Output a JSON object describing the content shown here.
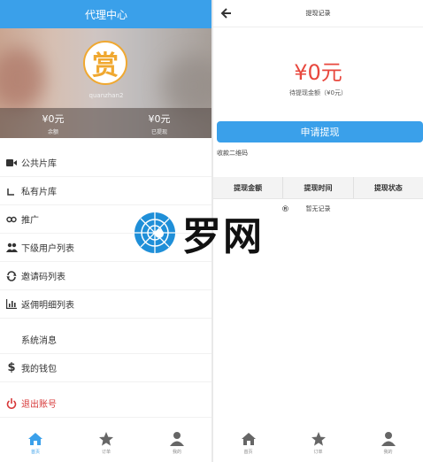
{
  "left": {
    "title": "代理中心",
    "avatar_char": "赏",
    "username": "quanzhan2",
    "stats": [
      {
        "value": "¥0元",
        "label": "余额"
      },
      {
        "value": "¥0元",
        "label": "已提现"
      }
    ],
    "menu": [
      {
        "icon": "video-camera-icon",
        "label": "公共片库"
      },
      {
        "icon": "folder-icon",
        "label": "私有片库"
      },
      {
        "icon": "share-link-icon",
        "label": "推广"
      },
      {
        "icon": "users-icon",
        "label": "下级用户列表"
      },
      {
        "icon": "refresh-icon",
        "label": "邀请码列表"
      },
      {
        "icon": "bar-chart-icon",
        "label": "返佣明细列表"
      },
      {
        "icon": "bell-icon",
        "label": "系统消息"
      },
      {
        "icon": "dollar-icon",
        "label": "我的钱包"
      },
      {
        "icon": "power-icon",
        "label": "退出账号"
      }
    ],
    "tabs": [
      {
        "icon": "home-icon",
        "label": "首页",
        "active": true
      },
      {
        "icon": "star-icon",
        "label": "订单",
        "active": false
      },
      {
        "icon": "user-icon",
        "label": "我的",
        "active": false
      }
    ]
  },
  "right": {
    "title": "提现记录",
    "amount": "¥0元",
    "pending": "待提现金额（¥0元）",
    "apply_button": "申请提现",
    "qr_label": "收款二维码",
    "columns": [
      "提现金额",
      "提现时间",
      "提现状态"
    ],
    "empty_text": "暂无记录",
    "tabs": [
      {
        "icon": "home-icon",
        "label": "首页"
      },
      {
        "icon": "star-icon",
        "label": "订单"
      },
      {
        "icon": "user-icon",
        "label": "我的"
      }
    ]
  },
  "watermark": {
    "text": "罗网",
    "mark": "®"
  },
  "colors": {
    "accent": "#3aa0ea",
    "amount": "#e8473d",
    "avatar_ring": "#f0a830",
    "logout": "#d7393a"
  }
}
